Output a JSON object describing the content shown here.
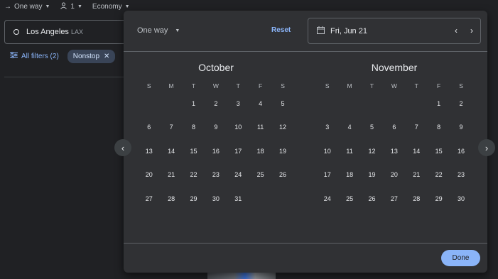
{
  "topbar": {
    "trip_type": "One way",
    "passengers": "1",
    "cabin": "Economy"
  },
  "search": {
    "origin_city": "Los Angeles",
    "origin_code": "LAX"
  },
  "filters": {
    "all_filters_label": "All filters (2)",
    "chip_label": "Nonstop"
  },
  "picker": {
    "trip_type": "One way",
    "reset_label": "Reset",
    "date_value": "Fri, Jun 21",
    "done_label": "Done",
    "weekdays": [
      "S",
      "M",
      "T",
      "W",
      "T",
      "F",
      "S"
    ],
    "months": [
      {
        "name": "October",
        "weeks": [
          [
            "",
            "",
            "1",
            "2",
            "3",
            "4",
            "5"
          ],
          [
            "6",
            "7",
            "8",
            "9",
            "10",
            "11",
            "12"
          ],
          [
            "13",
            "14",
            "15",
            "16",
            "17",
            "18",
            "19"
          ],
          [
            "20",
            "21",
            "22",
            "23",
            "24",
            "25",
            "26"
          ],
          [
            "27",
            "28",
            "29",
            "30",
            "31",
            "",
            ""
          ]
        ]
      },
      {
        "name": "November",
        "weeks": [
          [
            "",
            "",
            "",
            "",
            "",
            "1",
            "2"
          ],
          [
            "3",
            "4",
            "5",
            "6",
            "7",
            "8",
            "9"
          ],
          [
            "10",
            "11",
            "12",
            "13",
            "14",
            "15",
            "16"
          ],
          [
            "17",
            "18",
            "19",
            "20",
            "21",
            "22",
            "23"
          ],
          [
            "24",
            "25",
            "26",
            "27",
            "28",
            "29",
            "30"
          ]
        ]
      }
    ]
  }
}
